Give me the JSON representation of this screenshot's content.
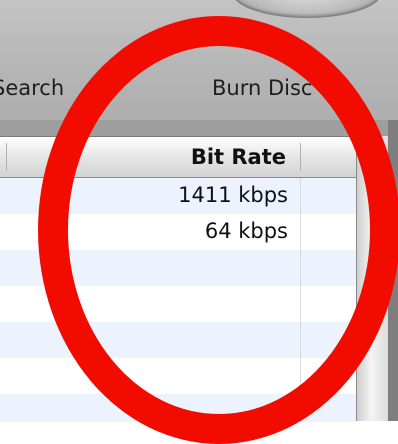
{
  "toolbar": {
    "search_label": "Search",
    "burn_label": "Burn Disc"
  },
  "list": {
    "column_header": "Bit Rate",
    "rows": [
      {
        "bit_rate": "1411 kbps"
      },
      {
        "bit_rate": "64 kbps"
      },
      {
        "bit_rate": ""
      },
      {
        "bit_rate": ""
      },
      {
        "bit_rate": ""
      },
      {
        "bit_rate": ""
      },
      {
        "bit_rate": ""
      }
    ]
  },
  "annotation": {
    "color": "#f20c00"
  }
}
